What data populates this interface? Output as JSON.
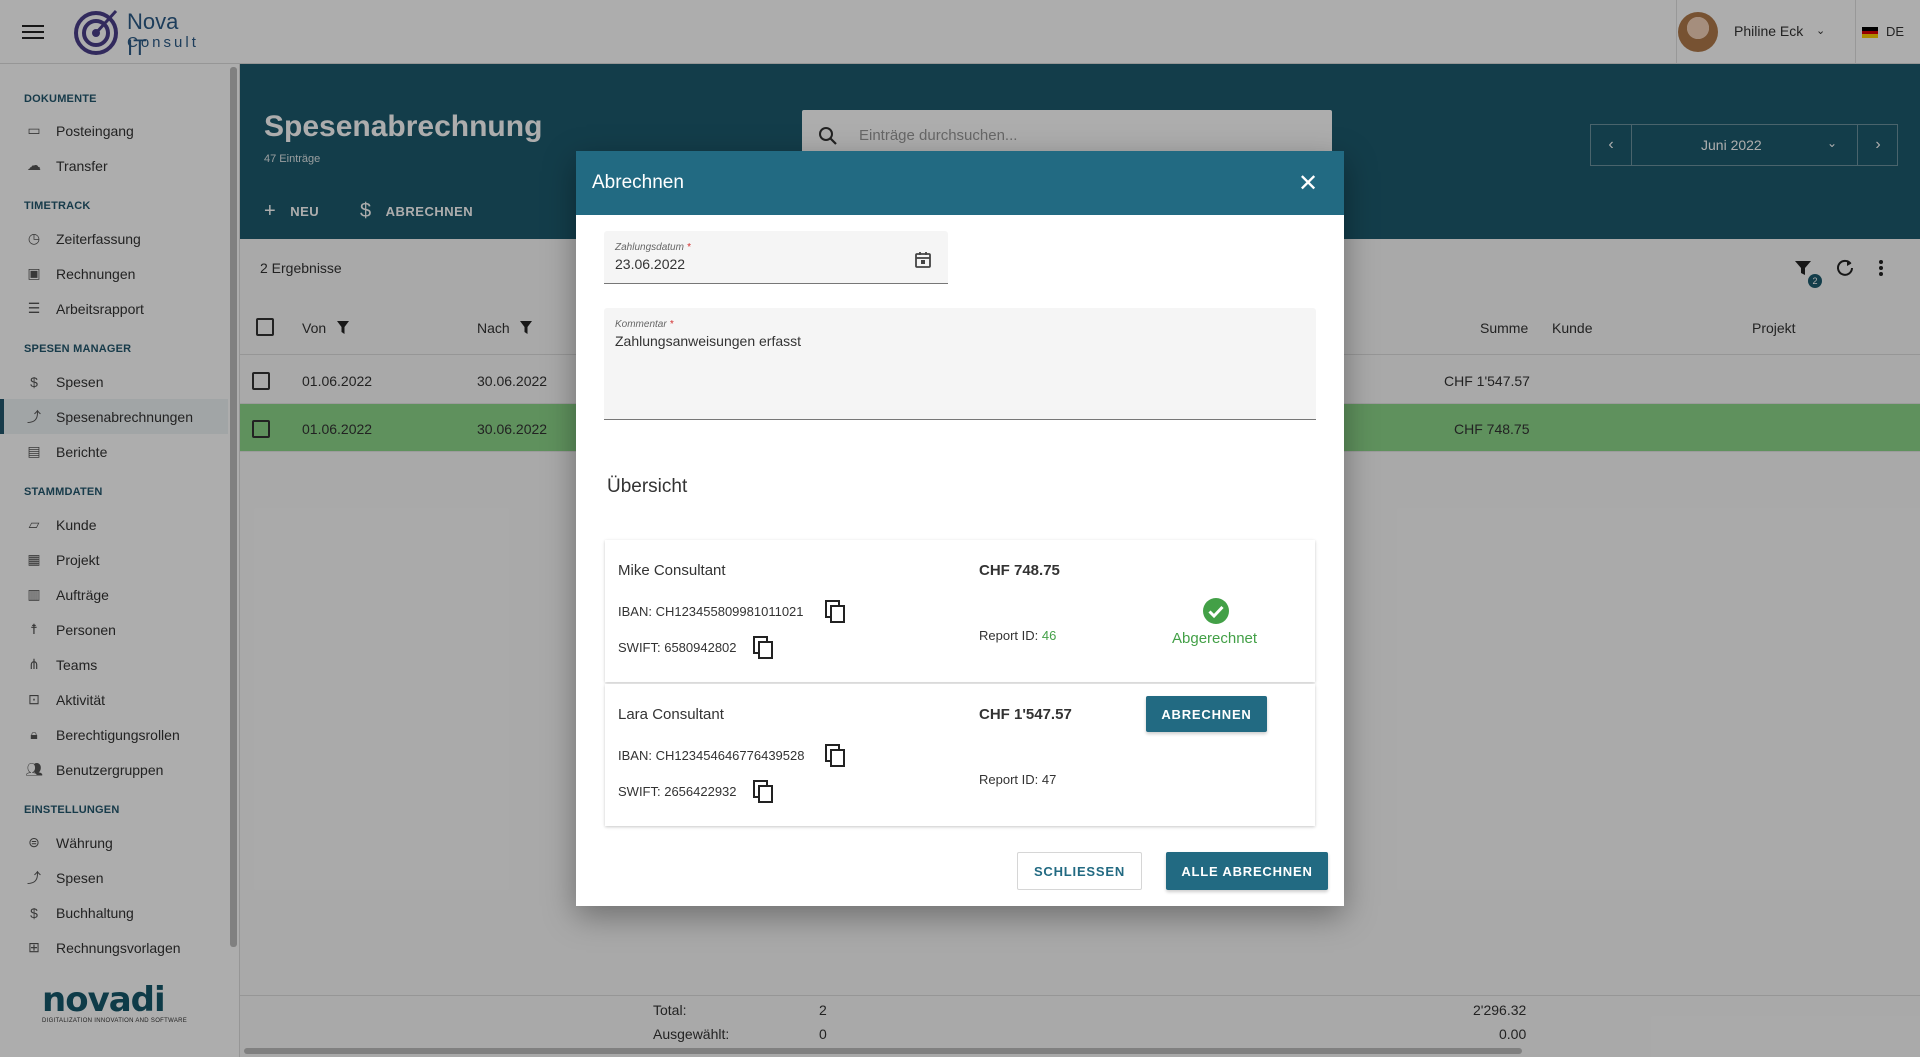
{
  "topbar": {
    "logo_line1": "Nova IT",
    "logo_line2": "Consult",
    "user_name": "Philine Eck",
    "language": "DE"
  },
  "sidebar": {
    "sections": [
      {
        "title": "DOKUMENTE",
        "items": [
          {
            "label": "Posteingang",
            "icon": "inbox-icon"
          },
          {
            "label": "Transfer",
            "icon": "cloud-upload-icon"
          }
        ]
      },
      {
        "title": "TIMETRACK",
        "items": [
          {
            "label": "Zeiterfassung",
            "icon": "clock-icon"
          },
          {
            "label": "Rechnungen",
            "icon": "invoice-icon"
          },
          {
            "label": "Arbeitsrapport",
            "icon": "list-icon"
          }
        ]
      },
      {
        "title": "SPESEN MANAGER",
        "items": [
          {
            "label": "Spesen",
            "icon": "dollar-icon"
          },
          {
            "label": "Spesenabrechnungen",
            "icon": "trend-icon",
            "active": true
          },
          {
            "label": "Berichte",
            "icon": "chart-icon"
          }
        ]
      },
      {
        "title": "STAMMDATEN",
        "items": [
          {
            "label": "Kunde",
            "icon": "folder-icon"
          },
          {
            "label": "Projekt",
            "icon": "document-icon"
          },
          {
            "label": "Aufträge",
            "icon": "calendar-icon"
          },
          {
            "label": "Personen",
            "icon": "person-icon"
          },
          {
            "label": "Teams",
            "icon": "hierarchy-icon"
          },
          {
            "label": "Aktivität",
            "icon": "activity-icon"
          },
          {
            "label": "Berechtigungsrollen",
            "icon": "lock-icon"
          },
          {
            "label": "Benutzergruppen",
            "icon": "group-icon"
          }
        ]
      },
      {
        "title": "EINSTELLUNGEN",
        "items": [
          {
            "label": "Währung",
            "icon": "currency-icon"
          },
          {
            "label": "Spesen",
            "icon": "trend-icon"
          },
          {
            "label": "Buchhaltung",
            "icon": "dollar-icon"
          },
          {
            "label": "Rechnungsvorlagen",
            "icon": "template-icon"
          }
        ]
      }
    ],
    "brand": "novadi",
    "brand_sub": "DIGITALIZATION INNOVATION AND SOFTWARE"
  },
  "header": {
    "title": "Spesenabrechnung",
    "subtitle": "47 Einträge",
    "btn_new": "NEU",
    "btn_settle": "ABRECHNEN",
    "search_placeholder": "Einträge durchsuchen...",
    "month": "Juni 2022"
  },
  "grid": {
    "results": "2 Ergebnisse",
    "filter_count": "2",
    "columns": {
      "von": "Von",
      "nach": "Nach",
      "summe": "Summe",
      "kunde": "Kunde",
      "projekt": "Projekt"
    },
    "rows": [
      {
        "von": "01.06.2022",
        "nach": "30.06.2022",
        "summe": "CHF 1'547.57"
      },
      {
        "von": "01.06.2022",
        "nach": "30.06.2022",
        "summe": "CHF 748.75"
      }
    ],
    "footer": {
      "total_label": "Total:",
      "total_count": "2",
      "total_sum": "2'296.32",
      "selected_label": "Ausgewählt:",
      "selected_count": "0",
      "selected_sum": "0.00"
    }
  },
  "dialog": {
    "title": "Abrechnen",
    "date_label": "Zahlungsdatum",
    "date_value": "23.06.2022",
    "comment_label": "Kommentar",
    "comment_value": "Zahlungsanweisungen erfasst",
    "required_mark": "*",
    "overview_title": "Übersicht",
    "cards": [
      {
        "name": "Mike Consultant",
        "iban": "IBAN: CH123455809981011021",
        "swift": "SWIFT: 6580942802",
        "amount": "CHF 748.75",
        "report_label": "Report ID:",
        "report_id": "46",
        "status": "Abgerechnet"
      },
      {
        "name": "Lara Consultant",
        "iban": "IBAN: CH123454646776439528",
        "swift": "SWIFT: 2656422932",
        "amount": "CHF 1'547.57",
        "report_label": "Report ID:",
        "report_id": "47",
        "action": "ABRECHNEN"
      }
    ],
    "btn_close": "SCHLIESSEN",
    "btn_all": "ALLE ABRECHNEN"
  },
  "colors": {
    "primary": "#1d5b6d",
    "dialog_header": "#226a82",
    "selected_row": "#8cd68a",
    "success": "#43a047"
  }
}
